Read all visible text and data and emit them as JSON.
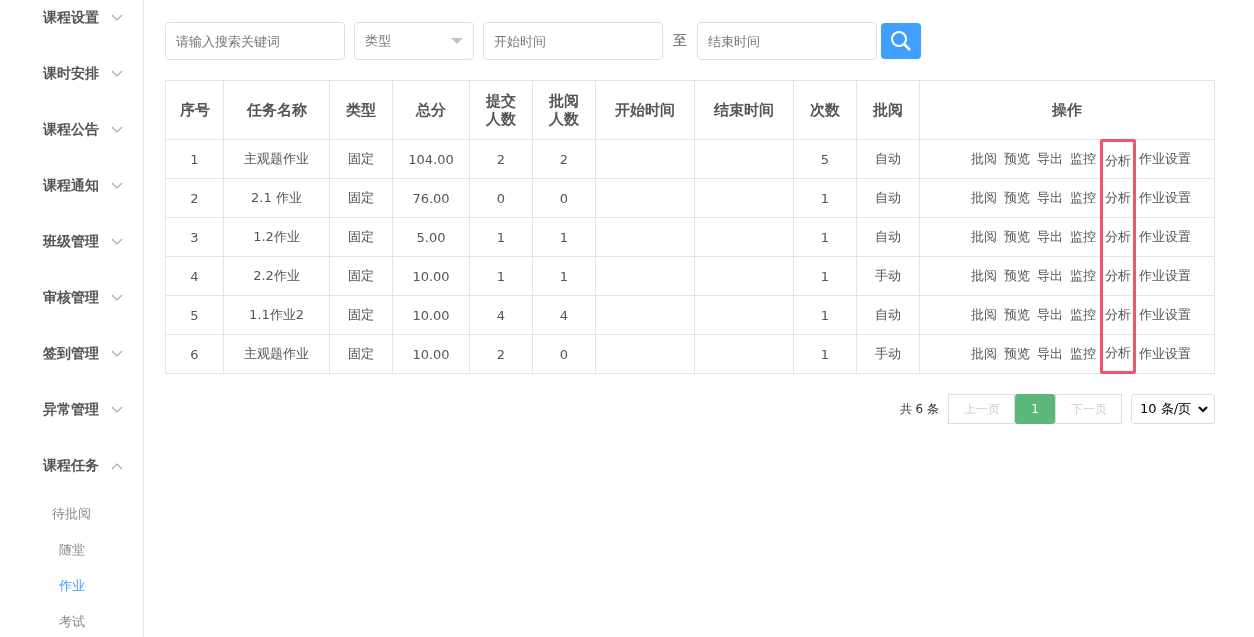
{
  "sidebar": {
    "items": [
      {
        "label": "课程设置",
        "expanded": false
      },
      {
        "label": "课时安排",
        "expanded": false
      },
      {
        "label": "课程公告",
        "expanded": false
      },
      {
        "label": "课程通知",
        "expanded": false
      },
      {
        "label": "班级管理",
        "expanded": false
      },
      {
        "label": "审核管理",
        "expanded": false
      },
      {
        "label": "签到管理",
        "expanded": false
      },
      {
        "label": "异常管理",
        "expanded": false
      },
      {
        "label": "课程任务",
        "expanded": true,
        "children": [
          {
            "label": "待批阅",
            "selected": false
          },
          {
            "label": "随堂",
            "selected": false
          },
          {
            "label": "作业",
            "selected": true
          },
          {
            "label": "考试",
            "selected": false
          }
        ]
      }
    ]
  },
  "filters": {
    "keyword": {
      "placeholder": "请输入搜索关键词"
    },
    "type": {
      "placeholder": "类型"
    },
    "start": {
      "placeholder": "开始时间"
    },
    "separator": "至",
    "end": {
      "placeholder": "结束时间"
    }
  },
  "table": {
    "columns": [
      "序号",
      "任务名称",
      "类型",
      "总分",
      "提交人数",
      "批阅人数",
      "开始时间",
      "结束时间",
      "次数",
      "批阅",
      "操作"
    ],
    "rows": [
      {
        "cells": [
          "1",
          "主观题作业",
          "固定",
          "104.00",
          "2",
          "2",
          "",
          "",
          "5",
          "自动"
        ],
        "actions": [
          {
            "label": "批阅",
            "highlighted": false
          },
          {
            "label": "预览",
            "highlighted": false
          },
          {
            "label": "导出",
            "highlighted": false
          },
          {
            "label": "监控",
            "highlighted": false
          },
          {
            "label": "分析",
            "highlighted": true
          },
          {
            "label": "作业设置",
            "highlighted": false
          }
        ]
      },
      {
        "cells": [
          "2",
          "2.1 作业",
          "固定",
          "76.00",
          "0",
          "0",
          "",
          "",
          "1",
          "自动"
        ],
        "actions": [
          {
            "label": "批阅",
            "highlighted": false
          },
          {
            "label": "预览",
            "highlighted": false
          },
          {
            "label": "导出",
            "highlighted": false
          },
          {
            "label": "监控",
            "highlighted": false
          },
          {
            "label": "分析",
            "highlighted": true
          },
          {
            "label": "作业设置",
            "highlighted": false
          }
        ]
      },
      {
        "cells": [
          "3",
          "1.2作业",
          "固定",
          "5.00",
          "1",
          "1",
          "",
          "",
          "1",
          "自动"
        ],
        "actions": [
          {
            "label": "批阅",
            "highlighted": false
          },
          {
            "label": "预览",
            "highlighted": false
          },
          {
            "label": "导出",
            "highlighted": false
          },
          {
            "label": "监控",
            "highlighted": false
          },
          {
            "label": "分析",
            "highlighted": true
          },
          {
            "label": "作业设置",
            "highlighted": false
          }
        ]
      },
      {
        "cells": [
          "4",
          "2.2作业",
          "固定",
          "10.00",
          "1",
          "1",
          "",
          "",
          "1",
          "手动"
        ],
        "actions": [
          {
            "label": "批阅",
            "highlighted": false
          },
          {
            "label": "预览",
            "highlighted": false
          },
          {
            "label": "导出",
            "highlighted": false
          },
          {
            "label": "监控",
            "highlighted": false
          },
          {
            "label": "分析",
            "highlighted": true
          },
          {
            "label": "作业设置",
            "highlighted": false
          }
        ]
      },
      {
        "cells": [
          "5",
          "1.1作业2",
          "固定",
          "10.00",
          "4",
          "4",
          "",
          "",
          "1",
          "自动"
        ],
        "actions": [
          {
            "label": "批阅",
            "highlighted": false
          },
          {
            "label": "预览",
            "highlighted": false
          },
          {
            "label": "导出",
            "highlighted": false
          },
          {
            "label": "监控",
            "highlighted": false
          },
          {
            "label": "分析",
            "highlighted": true
          },
          {
            "label": "作业设置",
            "highlighted": false
          }
        ]
      },
      {
        "cells": [
          "6",
          "主观题作业",
          "固定",
          "10.00",
          "2",
          "0",
          "",
          "",
          "1",
          "手动"
        ],
        "actions": [
          {
            "label": "批阅",
            "highlighted": false
          },
          {
            "label": "预览",
            "highlighted": false
          },
          {
            "label": "导出",
            "highlighted": false
          },
          {
            "label": "监控",
            "highlighted": false
          },
          {
            "label": "分析",
            "highlighted": true
          },
          {
            "label": "作业设置",
            "highlighted": false
          }
        ]
      }
    ]
  },
  "pagination": {
    "total": "共 6 条",
    "prev": "上一页",
    "pages": [
      {
        "label": "1",
        "selected": true
      }
    ],
    "next": "下一页",
    "page_size": "10 条/页"
  }
}
